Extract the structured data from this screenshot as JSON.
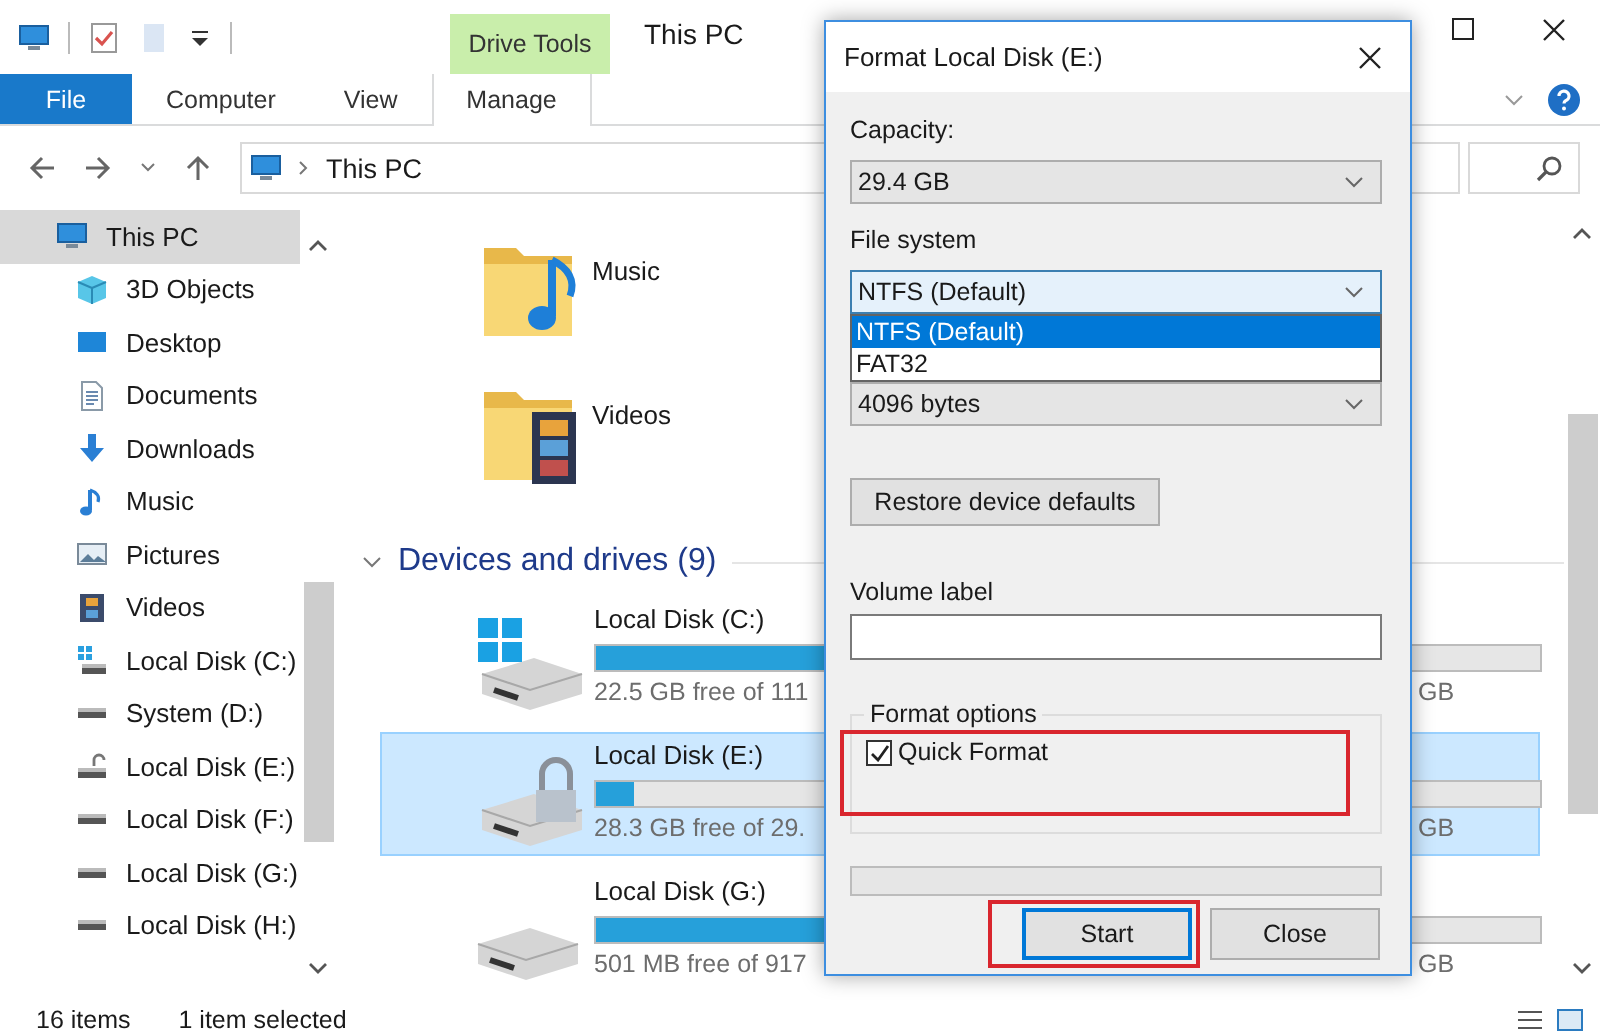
{
  "window": {
    "title": "This PC"
  },
  "ribbon": {
    "context_group": "Drive Tools",
    "tabs": [
      {
        "label": "File",
        "kind": "file"
      },
      {
        "label": "Computer",
        "kind": "tab"
      },
      {
        "label": "View",
        "kind": "tab"
      },
      {
        "label": "Manage",
        "kind": "contextual"
      }
    ]
  },
  "address_bar": {
    "path": "This PC"
  },
  "nav_pane": {
    "items": [
      {
        "label": "This PC",
        "kind": "pc",
        "selected": true,
        "children": [
          {
            "label": "3D Objects",
            "kind": "cube",
            "selected": false
          },
          {
            "label": "Desktop",
            "kind": "desktop",
            "selected": false
          },
          {
            "label": "Documents",
            "kind": "documents",
            "selected": false
          },
          {
            "label": "Downloads",
            "kind": "downloads",
            "selected": false
          },
          {
            "label": "Music",
            "kind": "music",
            "selected": false
          },
          {
            "label": "Pictures",
            "kind": "pictures",
            "selected": false
          },
          {
            "label": "Videos",
            "kind": "videos",
            "selected": false
          },
          {
            "label": "Local Disk (C:)",
            "kind": "system-drive",
            "selected": false
          },
          {
            "label": "System (D:)",
            "kind": "drive",
            "selected": false
          },
          {
            "label": "Local Disk (E:)",
            "kind": "locked-drive",
            "selected": false
          },
          {
            "label": "Local Disk (F:)",
            "kind": "drive",
            "selected": false
          },
          {
            "label": "Local Disk (G:)",
            "kind": "drive",
            "selected": false
          },
          {
            "label": "Local Disk (H:)",
            "kind": "drive",
            "selected": false
          }
        ]
      }
    ]
  },
  "folders": [
    {
      "name": "Music",
      "kind": "music"
    },
    {
      "name": "Videos",
      "kind": "videos"
    }
  ],
  "devices_section": {
    "title": "Devices and drives (9)",
    "expanded": true
  },
  "drives": [
    {
      "name": "Local Disk (C:)",
      "kind": "system-drive",
      "level": 0.8,
      "free": "22.5 GB free of 111",
      "free_tail": "GB",
      "selected": false
    },
    {
      "name": "Local Disk (E:)",
      "kind": "locked-drive",
      "level": 0.04,
      "free": "28.3 GB free of 29.",
      "free_tail": "GB",
      "selected": true
    },
    {
      "name": "Local Disk (G:)",
      "kind": "drive",
      "level": 0.45,
      "free": "501 MB free of 917",
      "free_tail": "GB",
      "selected": false
    }
  ],
  "format_dialog": {
    "title": "Format Local Disk (E:)",
    "capacity": {
      "label": "Capacity:",
      "value": "29.4 GB"
    },
    "file_system": {
      "label": "File system",
      "value": "NTFS (Default)",
      "open": true,
      "options": [
        {
          "label": "NTFS (Default)",
          "selected": true
        },
        {
          "label": "FAT32",
          "selected": false
        }
      ]
    },
    "allocation_unit": {
      "value": "4096 bytes"
    },
    "restore_button": "Restore device defaults",
    "volume_label": {
      "label": "Volume label"
    },
    "format_options": {
      "title": "Format options",
      "quick_format": {
        "label": "Quick Format",
        "checked": true,
        "annotated": true
      }
    },
    "progress": {
      "level": 0
    },
    "buttons": [
      {
        "label": "Start",
        "focused": true,
        "annotated": true
      },
      {
        "label": "Close",
        "focused": false,
        "annotated": false
      }
    ]
  },
  "status_bar": {
    "item_count": "16 items",
    "selection": "1 item selected"
  }
}
